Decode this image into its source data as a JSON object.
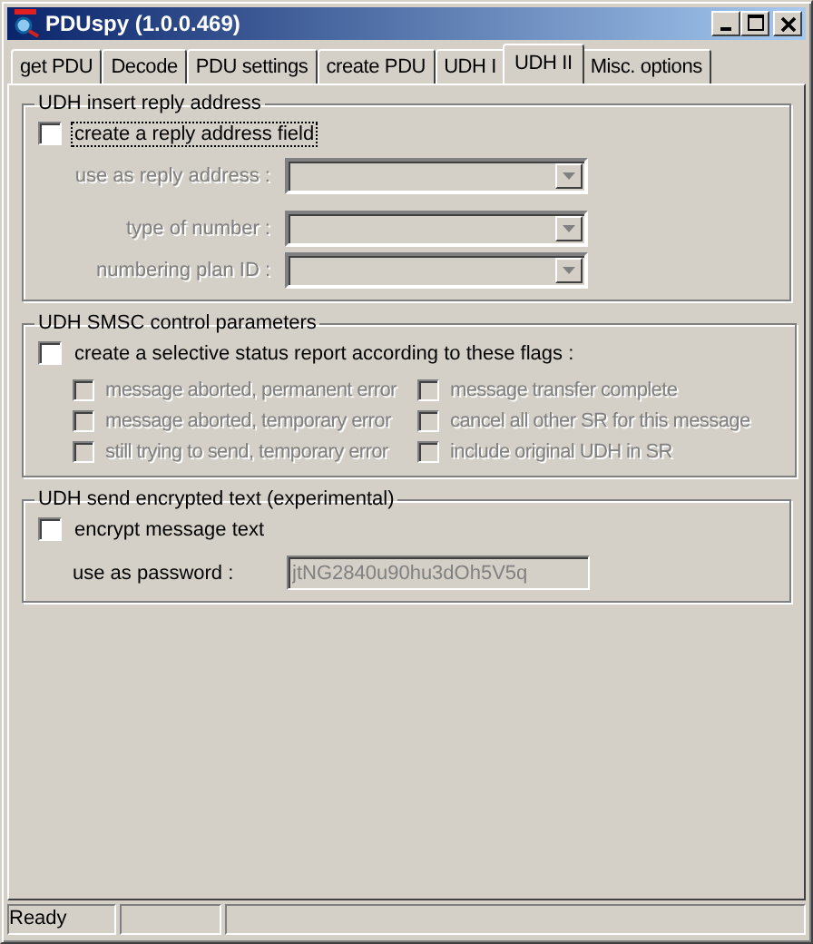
{
  "window": {
    "title": "PDUspy (1.0.0.469)"
  },
  "tabs": [
    {
      "label": "get PDU",
      "selected": false
    },
    {
      "label": "Decode",
      "selected": false
    },
    {
      "label": "PDU settings",
      "selected": false
    },
    {
      "label": "create PDU",
      "selected": false
    },
    {
      "label": "UDH I",
      "selected": false
    },
    {
      "label": "UDH II",
      "selected": true
    },
    {
      "label": "Misc. options",
      "selected": false
    }
  ],
  "reply_address": {
    "title": "UDH insert reply address",
    "checkbox": {
      "label": "create a reply address field",
      "checked": false,
      "focused": true
    },
    "dropdowns": [
      {
        "label": "use as reply address :",
        "disabled": true
      },
      {
        "label": "type of number :",
        "disabled": true
      },
      {
        "label": "numbering plan ID :",
        "disabled": true
      }
    ]
  },
  "smsc": {
    "title": "UDH SMSC control parameters",
    "checkbox": {
      "label": "create a selective status report according to these flags :",
      "checked": false,
      "focused": false
    },
    "flags": [
      {
        "label": "message aborted, permanent error",
        "checked": false,
        "disabled": true
      },
      {
        "label": "message transfer complete",
        "checked": false,
        "disabled": true
      },
      {
        "label": "message aborted, temporary error",
        "checked": false,
        "disabled": true
      },
      {
        "label": "cancel all other SR for this message",
        "checked": false,
        "disabled": true
      },
      {
        "label": "still trying to send, temporary error",
        "checked": false,
        "disabled": true
      },
      {
        "label": "include original UDH in SR",
        "checked": false,
        "disabled": true
      }
    ]
  },
  "encrypted": {
    "title": "UDH send encrypted text (experimental)",
    "checkbox": {
      "label": "encrypt message text",
      "checked": false,
      "focused": false
    },
    "password": {
      "label": "use as password :",
      "value": "jtNG2840u90hu3dOh5V5q",
      "disabled": true
    }
  },
  "status_bar": {
    "text": "Ready"
  }
}
